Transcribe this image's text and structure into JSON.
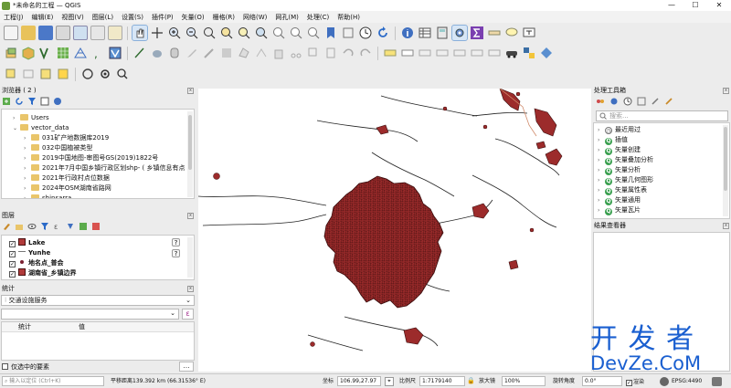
{
  "window": {
    "title": "*未命名的工程 — QGIS"
  },
  "menubar": {
    "items": [
      "工程(J)",
      "编辑(E)",
      "视图(V)",
      "图层(L)",
      "设置(S)",
      "插件(P)",
      "矢量(O)",
      "栅格(R)",
      "网络(W)",
      "网孔(M)",
      "处理(C)",
      "帮助(H)"
    ]
  },
  "browser": {
    "title": "浏览器 ( 2 )",
    "items": [
      {
        "label": "Users",
        "level": 1
      },
      {
        "label": "vector_data",
        "level": 1
      },
      {
        "label": "031矿产地数据库2019",
        "level": 2
      },
      {
        "label": "032中国植被类型",
        "level": 2
      },
      {
        "label": "2019中国地图-审图号GS(2019)1822号",
        "level": 2
      },
      {
        "label": "2021年7月中国乡镇行政区划shp- ( 乡镇信息有点",
        "level": 2
      },
      {
        "label": "2021年行政村点位数据",
        "level": 2
      },
      {
        "label": "2024年OSM湖南省路网",
        "level": 2
      },
      {
        "label": "shinsarra",
        "level": 2
      }
    ]
  },
  "layers": {
    "title": "图层",
    "items": [
      {
        "label": "Lake",
        "color": "#b03a3a",
        "kind": "polygon"
      },
      {
        "label": "Yunhe",
        "color": "#777777",
        "kind": "line"
      },
      {
        "label": "地名点_普会",
        "color": "#7a2030",
        "kind": "point"
      },
      {
        "label": "湖南省_乡镇边界",
        "color": "#b03a3a",
        "kind": "polygon"
      }
    ]
  },
  "statistics": {
    "title": "统计",
    "layer_value": "交通设施服务",
    "columns": [
      "统计",
      "值"
    ],
    "only_selected_label": "仅选中的要素"
  },
  "processing": {
    "title": "处理工具箱",
    "search_placeholder": "搜索...",
    "items": [
      "最近用过",
      "插值",
      "矢量创建",
      "矢量叠加分析",
      "矢量分析",
      "矢量几何图形",
      "矢量属性表",
      "矢量通用",
      "矢量瓦片"
    ]
  },
  "results": {
    "title": "结果查看器"
  },
  "statusbar": {
    "locator_placeholder": "输入以定位 (Ctrl+K)",
    "measure": "平移距离139.392 km (66.31536° E)",
    "coord_label": "坐标",
    "coord_value": "106.99,27.97",
    "scale_label": "比例尺",
    "scale_value": "1:7179140",
    "magnifier_label": "放大镜",
    "magnifier_value": "100%",
    "rotation_label": "旋转角度",
    "rotation_value": "0.0°",
    "render_label": "渲染",
    "crs_value": "EPSG:4490"
  },
  "watermark": {
    "line1": "开 发 者",
    "line2": "DevZe.CoM"
  },
  "colors": {
    "polygon_fill": "#9c2b2b",
    "polygon_stroke": "#3a0d0d",
    "watermark": "#1a5fd0"
  }
}
